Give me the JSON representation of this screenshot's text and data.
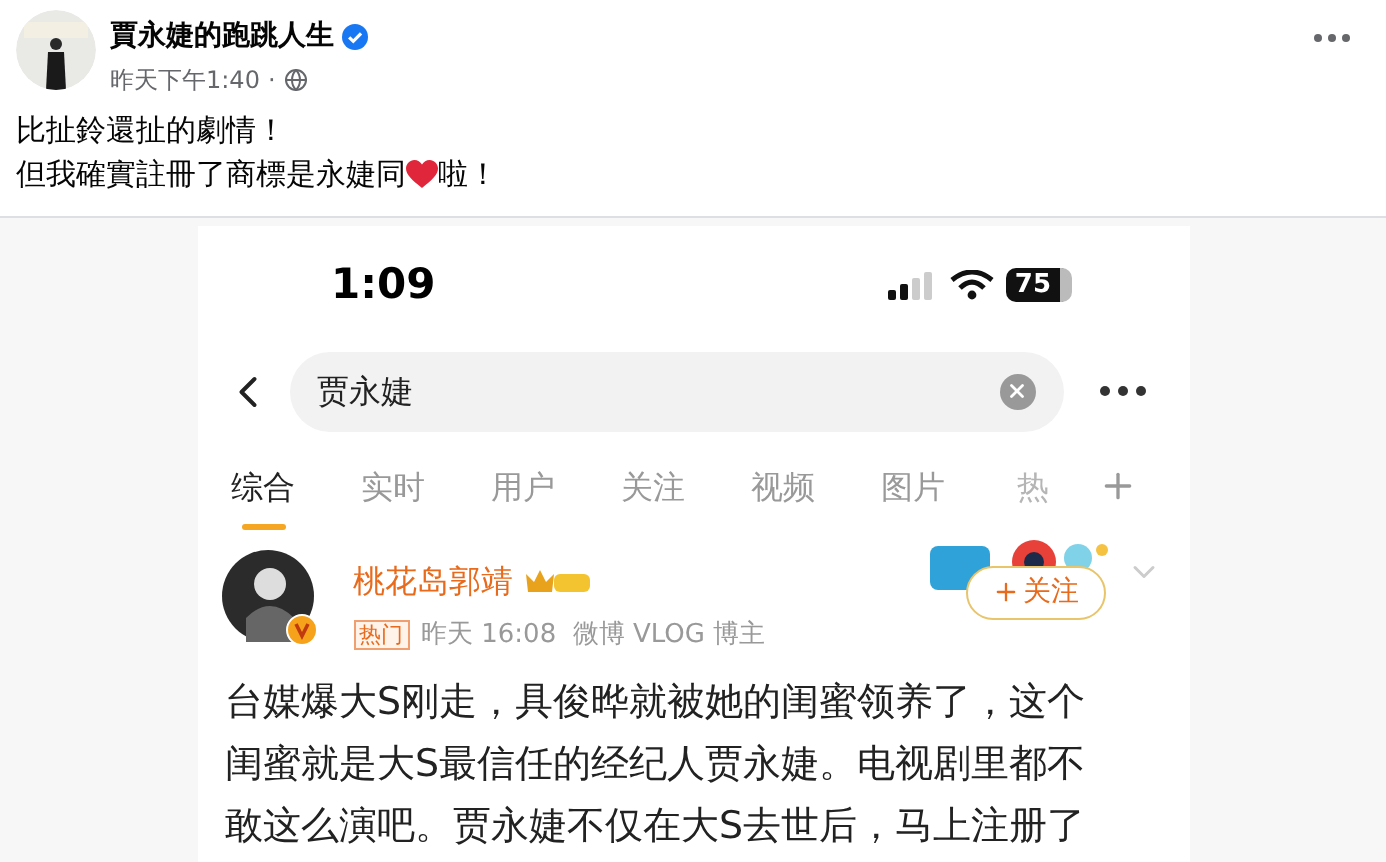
{
  "post": {
    "author": "賈永婕的跑跳人生",
    "verified": true,
    "time": "昨天下午1:40",
    "dot": "·",
    "line1": "比扯鈴還扯的劇情！",
    "line2_before": "但我確實註冊了商標是永婕同",
    "line2_after": "啦！"
  },
  "phone": {
    "status_time": "1:09",
    "battery": "75",
    "search_value": "贾永婕",
    "tabs": [
      {
        "label": "综合",
        "selected": true,
        "faded": false
      },
      {
        "label": "实时",
        "selected": false,
        "faded": false
      },
      {
        "label": "用户",
        "selected": false,
        "faded": false
      },
      {
        "label": "关注",
        "selected": false,
        "faded": false
      },
      {
        "label": "视频",
        "selected": false,
        "faded": false
      },
      {
        "label": "图片",
        "selected": false,
        "faded": false
      },
      {
        "label": "热",
        "selected": false,
        "faded": true
      }
    ],
    "weibo": {
      "author": "桃花岛郭靖",
      "tag": "热门",
      "meta": "昨天 16:08  微博 VLOG 博主",
      "follow": "关注",
      "lines": [
        "台媒爆大S刚走，具俊晔就被她的闺蜜领养了，这个",
        "闺蜜就是大S最信任的经纪人贾永婕。电视剧里都不",
        "敢这么演吧。贾永婕不仅在大S去世后，马上注册了"
      ]
    }
  }
}
